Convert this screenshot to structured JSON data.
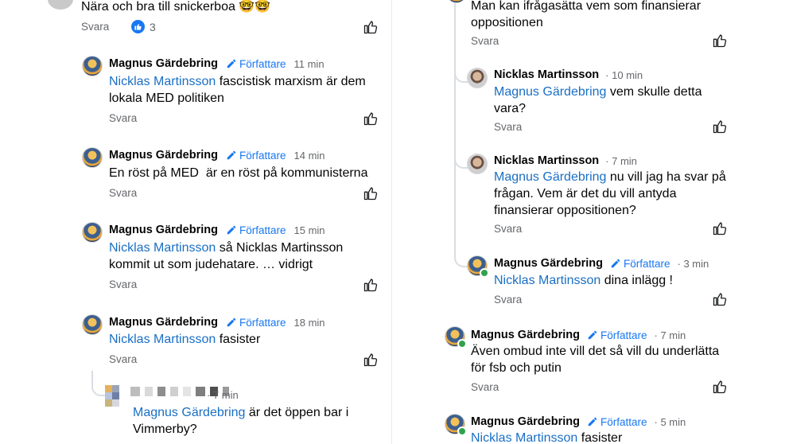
{
  "left": {
    "top_comment": {
      "text": "Nära och bra till snickerboa 🤓🤓",
      "reply": "Svara",
      "like_count": "3"
    },
    "comments": [
      {
        "author": "Magnus Gärdebring",
        "badge": "Författare",
        "time": "11 min",
        "mention": "Nicklas Martinsson",
        "line1": " fascistisk marxism är dem",
        "line2": "lokala MED politiken",
        "reply": "Svara"
      },
      {
        "author": "Magnus Gärdebring",
        "badge": "Författare",
        "time": "14 min",
        "line1": "En röst på MED  är en röst på kommunisterna",
        "reply": "Svara"
      },
      {
        "author": "Magnus Gärdebring",
        "badge": "Författare",
        "time": "15 min",
        "mention": "Nicklas Martinsson",
        "line1": " så Nicklas Martinsson",
        "line2": "kommit ut som judehatare. … vidrigt",
        "reply": "Svara"
      },
      {
        "author": "Magnus Gärdebring",
        "badge": "Författare",
        "time": "18 min",
        "mention": "Nicklas Martinsson",
        "line1": " fasister",
        "reply": "Svara"
      }
    ],
    "nested": {
      "time": "7 min",
      "mention": "Magnus Gärdebring",
      "line1": " är det öppen bar i",
      "line2": "Vimmerby?"
    }
  },
  "right": {
    "top_comment": {
      "line1": "Man kan ifrågasätta vem som finansierar",
      "line2": "oppositionen",
      "reply": "Svara"
    },
    "replies": [
      {
        "author": "Nicklas Martinsson",
        "time": "10 min",
        "mention": "Magnus Gärdebring",
        "line1": " vem skulle detta",
        "line2": "vara?",
        "reply": "Svara"
      },
      {
        "author": "Nicklas Martinsson",
        "time": "7 min",
        "mention": "Magnus Gärdebring",
        "line1": " nu vill jag ha svar på",
        "line2": "frågan. Vem är det du vill antyda",
        "line3": "finansierar oppositionen?",
        "reply": "Svara"
      },
      {
        "author": "Magnus Gärdebring",
        "badge": "Författare",
        "time": "3 min",
        "mention": "Nicklas Martinsson",
        "line1": " dina inlägg !",
        "reply": "Svara"
      }
    ],
    "comments": [
      {
        "author": "Magnus Gärdebring",
        "badge": "Författare",
        "time": "7 min",
        "line1": "Även ombud inte vill det så vill du underlätta",
        "line2": "för fsb och putin",
        "reply": "Svara"
      },
      {
        "author": "Magnus Gärdebring",
        "badge": "Författare",
        "time": "5 min",
        "mention": "Nicklas Martinsson",
        "line1": " fasister"
      }
    ]
  },
  "colors": {
    "link": "#1a6fc4",
    "author_badge": "#1877f2",
    "muted": "#65676b",
    "online": "#31a24c"
  }
}
